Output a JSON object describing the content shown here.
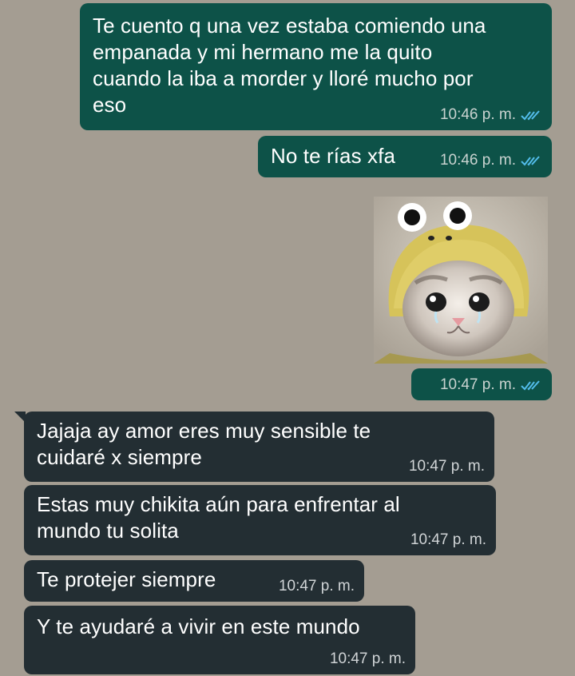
{
  "chat": {
    "messages": [
      {
        "direction": "outgoing",
        "text": "Te cuento q una vez estaba comiendo una empanada y mi hermano me la quito cuando la iba a morder y lloré mucho por eso",
        "lines": [
          "Te cuento q una vez estaba comiendo una",
          "empanada y mi hermano me la quito",
          "cuando la iba a morder y lloré mucho por",
          "eso"
        ],
        "time": "10:46 p. m.",
        "status": "read"
      },
      {
        "direction": "outgoing",
        "text": "No te rías xfa",
        "time": "10:46 p. m.",
        "status": "read"
      },
      {
        "direction": "outgoing",
        "type": "image",
        "image": "crying-cat-in-frog-hat-sticker",
        "time": "10:47 p. m.",
        "status": "read"
      },
      {
        "direction": "incoming",
        "lines": [
          "Jajaja ay amor eres muy sensible te",
          "cuidaré x siempre"
        ],
        "time": "10:47 p. m."
      },
      {
        "direction": "incoming",
        "lines": [
          "Estas muy chikita aún para enfrentar al",
          "mundo tu solita"
        ],
        "time": "10:47 p. m."
      },
      {
        "direction": "incoming",
        "text": "Te protejer siempre",
        "time": "10:47 p. m."
      },
      {
        "direction": "incoming",
        "text": "Y te ayudaré a vivir en este mundo",
        "time": "10:47 p. m."
      }
    ]
  },
  "colors": {
    "background": "#a49d92",
    "outgoing_bubble": "#0d5248",
    "incoming_bubble": "#232e33",
    "read_ticks": "#53bdeb"
  },
  "icons": {
    "read_receipt": "double-check-icon"
  }
}
